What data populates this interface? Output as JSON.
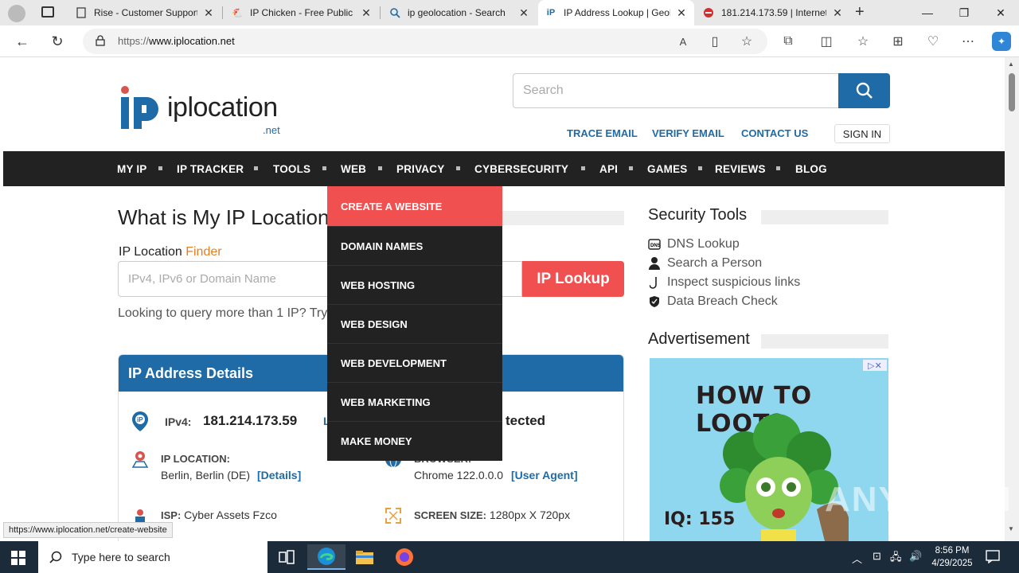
{
  "browser": {
    "tabs": [
      {
        "title": "Rise - Customer Support",
        "close": "✕"
      },
      {
        "title": "IP Chicken - Free Public I",
        "close": "✕"
      },
      {
        "title": "ip geolocation - Search",
        "close": "✕"
      },
      {
        "title": "IP Address Lookup | Geol",
        "close": "✕"
      },
      {
        "title": "181.214.173.59 | Internet",
        "close": "✕"
      }
    ],
    "new_tab": "+",
    "window_controls": {
      "minimize": "—",
      "restore": "❐",
      "close": "✕"
    },
    "url_scheme": "https://",
    "url_host": "www.iplocation.net",
    "status_link": "https://www.iplocation.net/create-website"
  },
  "site": {
    "logo_text": "iplocation",
    "logo_suffix": ".net",
    "search_placeholder": "Search",
    "top_links": {
      "trace_email": "TRACE EMAIL",
      "verify_email": "VERIFY EMAIL",
      "contact_us": "CONTACT US",
      "sign_in": "SIGN IN"
    },
    "nav": [
      "MY IP",
      "IP TRACKER",
      "TOOLS",
      "WEB",
      "PRIVACY",
      "CYBERSECURITY",
      "API",
      "GAMES",
      "REVIEWS",
      "BLOG"
    ],
    "dropdown": [
      "CREATE A WEBSITE",
      "DOMAIN NAMES",
      "WEB HOSTING",
      "WEB DESIGN",
      "WEB DEVELOPMENT",
      "WEB MARKETING",
      "MAKE MONEY"
    ]
  },
  "main": {
    "heading": "What is My IP Location",
    "finder_label": "IP Location ",
    "finder_accent": "Finder",
    "input_placeholder": "IPv4, IPv6 or Domain Name",
    "lookup_button": "IP Lookup",
    "query_text": "Looking to query more than 1 IP? Try o",
    "details": {
      "title": "IP Address Details",
      "ipv4_label": "IPv4:",
      "ipv4_value": "181.214.173.59",
      "ipv4_partial": "L",
      "detected_partial": "tected",
      "location_label": "IP LOCATION:",
      "location_value": "Berlin, Berlin (DE)",
      "location_link": "[Details]",
      "browser_label_partial": "BROWSER:",
      "browser_value": "Chrome 122.0.0.0",
      "browser_link": "[User Agent]",
      "isp_label": "ISP:",
      "isp_value": " Cyber Assets Fzco",
      "screen_label": "SCREEN SIZE:",
      "screen_value": " 1280px X 720px"
    }
  },
  "sidebar": {
    "security_title": "Security Tools",
    "security_items": [
      "DNS Lookup",
      "Search a Person",
      "Inspect suspicious links",
      "Data Breach Check"
    ],
    "ad_title": "Advertisement",
    "ad_headline": "HOW TO LOOT?",
    "ad_iq": "IQ: 155",
    "ad_badge": "▷✕"
  },
  "watermark": "ANY▷RUN",
  "taskbar": {
    "search_placeholder": "Type here to search",
    "time": "8:56 PM",
    "date": "4/29/2025"
  },
  "colors": {
    "brand_blue": "#1e6ba8",
    "accent_red": "#f05050",
    "nav_dark": "#222222",
    "finder_orange": "#e67e22"
  }
}
